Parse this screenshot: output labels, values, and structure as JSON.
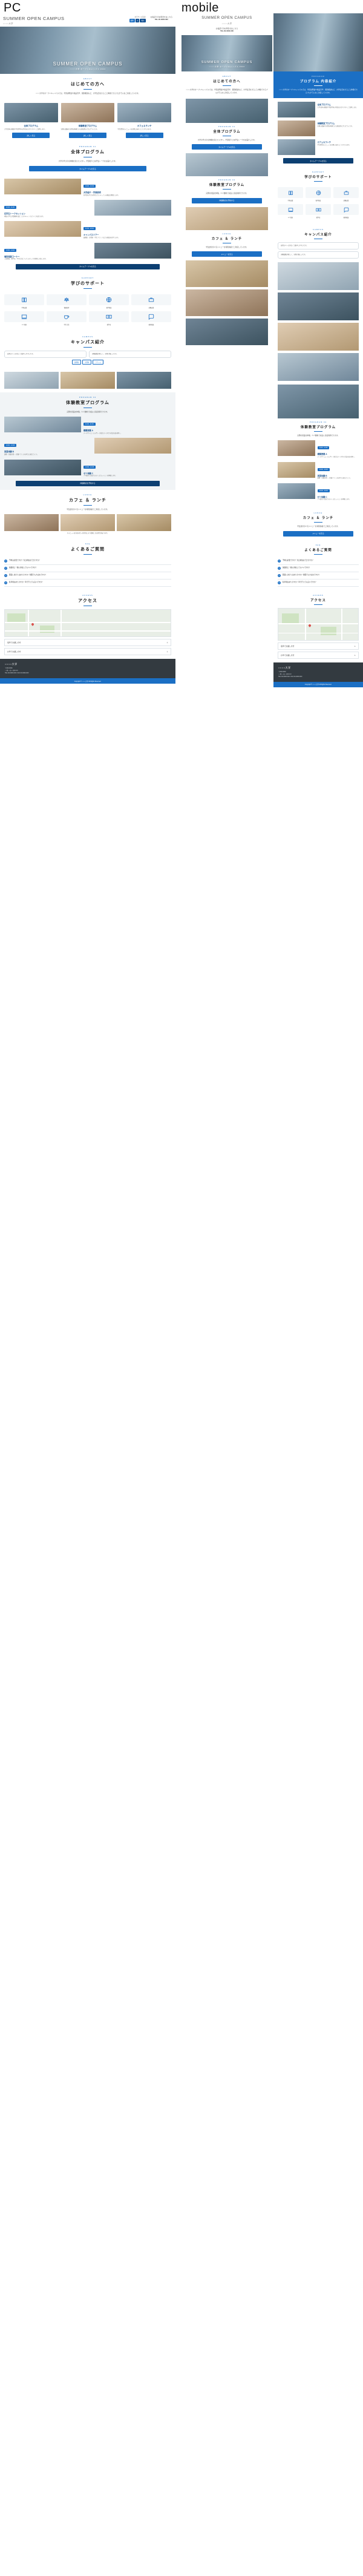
{
  "page": {
    "label_pc": "PC",
    "label_mobile": "mobile"
  },
  "header": {
    "title": "SUMMER OPEN CAMPUS",
    "subtitle": "○○○○大学",
    "text_size_label": "文字サイズ変更",
    "text_size_buttons": [
      "標準",
      "大",
      "特大"
    ],
    "tel_label": "お電話でのお問合せはこちら",
    "tel_number": "TEL.00-0000-000"
  },
  "hero": {
    "title": "SUMMER OPEN CAMPUS",
    "subtitle": "○○○○大学 オープンキャンパス 2024"
  },
  "intro": {
    "kicker": "ABOUT",
    "title": "はじめての方へ",
    "lead": "○○○○大学のオープンキャンパスでは、学部説明会や施設見学、個別相談など、大学生活をまるごと体験できるプログラムをご用意しています。"
  },
  "program_cards": {
    "kicker": "PROGRAM",
    "title": "プログラム 内容紹介",
    "cards": [
      {
        "name": "全体プログラム",
        "text": "大学全体の概要や学部学科の特色を分かりやすくご説明します。",
        "button": "詳しく見る"
      },
      {
        "name": "体験教室プログラム",
        "text": "実際の講義や実習を体験できる参加型のプログラムです。",
        "button": "詳しく見る"
      },
      {
        "name": "カフェ＆ランチ",
        "text": "学生食堂のメニューを実際に味わうことができます。",
        "button": "詳しく見る"
      }
    ]
  },
  "whole_program": {
    "kicker": "PROGRAM 01",
    "title": "全体プログラム",
    "lead": "大学の学びの全体像を知りたい方へ。学部紹介と在学生トークをお届けします。",
    "button": "タイムテーブルを見る",
    "items": [
      {
        "time": "10:00 - 10:30",
        "name": "大学紹介・学部説明",
        "text": "各学部の学びの特色とカリキュラムを教員が解説します。"
      },
      {
        "time": "10:40 - 11:20",
        "name": "在学生トークセッション",
        "text": "現役の学生が受験期の過ごし方やキャンパスライフを語ります。"
      },
      {
        "time": "11:30 - 12:10",
        "name": "キャンパスツアー",
        "text": "図書館・実習室・学生ラウンジなどの施設を見学します。"
      },
      {
        "time": "13:00 - 14:00",
        "name": "個別相談コーナー",
        "text": "入試制度、奨学金、学生生活についてスタッフが個別に対応します。"
      }
    ]
  },
  "facility": {
    "kicker": "CAMPUS",
    "title": "キャンパス紹介",
    "lead": "充実した設備と落ち着いた学習環境をご覧ください。",
    "tags": [
      "図書館",
      "実習室",
      "ラウンジ"
    ],
    "bubbles": [
      "自習スペースが広くて集中しやすいです。",
      "実験設備が新しく、実習が楽しいです。"
    ]
  },
  "experience": {
    "kicker": "PROGRAM 02",
    "title": "体験教室プログラム",
    "lead": "実際の授業を体験。少人数制で先生に直接質問できます。",
    "button": "体験教室を予約する",
    "items": [
      {
        "time": "11:00 - 11:45",
        "name": "模擬授業 A",
        "text": "データサイエンス入門 ― 身近なデータから社会を読み解く。"
      },
      {
        "time": "13:00 - 13:45",
        "name": "実習体験 B",
        "text": "調理・栄養実習 ― 栄養バランスを考えた献立づくり。"
      },
      {
        "time": "14:00 - 14:45",
        "name": "ゼミ体験 C",
        "text": "少人数ゼミ形式でのディスカッションを体験します。"
      }
    ]
  },
  "illustrations": {
    "kicker": "SUPPORT",
    "title": "学びのサポート",
    "items": [
      {
        "icon": "book-icon",
        "caption": "学習支援"
      },
      {
        "icon": "scale-icon",
        "caption": "資格取得"
      },
      {
        "icon": "globe-icon",
        "caption": "留学制度"
      },
      {
        "icon": "briefcase-icon",
        "caption": "就職支援"
      },
      {
        "icon": "pc-icon",
        "caption": "ICT環境"
      },
      {
        "icon": "cup-icon",
        "caption": "学生生活"
      },
      {
        "icon": "money-icon",
        "caption": "奨学金"
      },
      {
        "icon": "chat-icon",
        "caption": "個別相談"
      }
    ]
  },
  "cafe": {
    "kicker": "LUNCH",
    "title": "カフェ ＆ ランチ",
    "lead": "学生食堂の人気メニューを特別価格でご用意しています。",
    "menu_note": "※メニューは当日の仕入れ状況により変更になる場合があります。",
    "button": "メニューを見る"
  },
  "faq": {
    "kicker": "FAQ",
    "title": "よくあるご質問",
    "items": [
      "予約は必要ですか？当日参加はできますか？",
      "保護者と一緒に参加してもいいですか？",
      "服装に決まりはありますか？制服でも大丈夫ですか？",
      "駐車場はありますか？車で行っても良いですか？"
    ]
  },
  "access": {
    "kicker": "ACCESS",
    "title": "アクセス",
    "map_label": "○○○○大学 キャンパス",
    "rows": [
      "電車でお越しの方",
      "お車でお越しの方"
    ],
    "chevron": "＋"
  },
  "footer": {
    "brand": "○○○○大学",
    "address": "〒000-0000\n○○県○○市○○町0-0-0\nTEL.00-0000-000 / FAX.00-0000-000",
    "copyright": "Copyright © ○○○○大学 All Rights Reserved."
  },
  "colors": {
    "accent": "#1b6fc4",
    "accent_dark": "#0c3f72",
    "text": "#333333",
    "gray_bg": "#f1f4f6",
    "footer_bg": "#333a40"
  }
}
